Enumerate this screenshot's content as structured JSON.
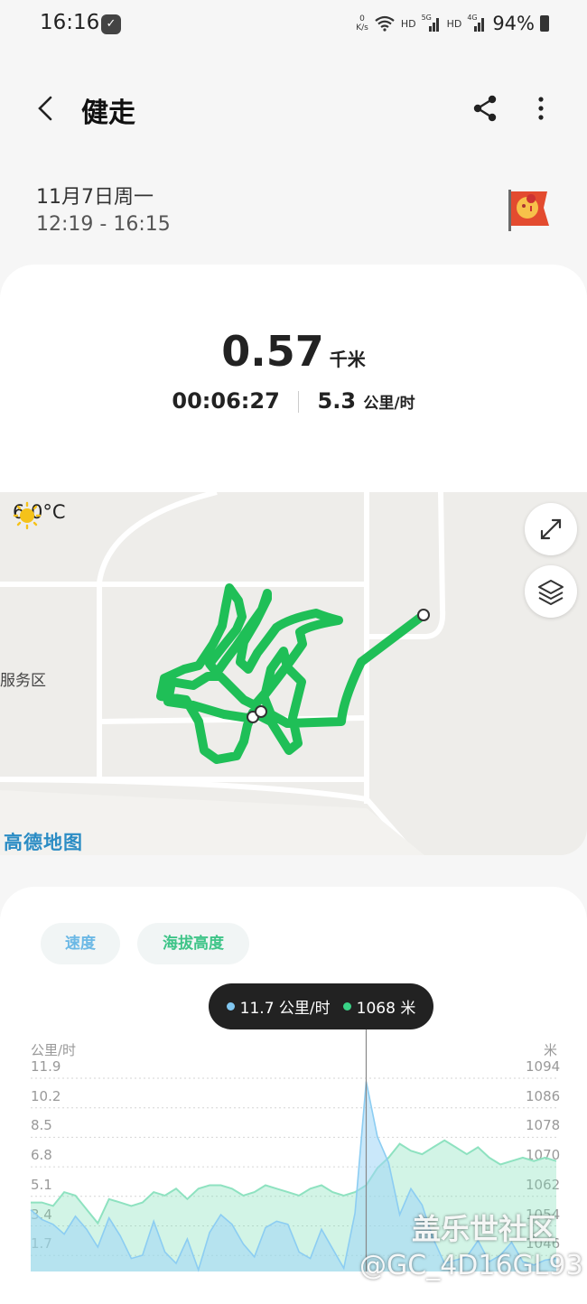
{
  "status": {
    "time": "16:16",
    "net_speed_value": "0",
    "net_speed_unit": "K/s",
    "hd1": "HD",
    "sig1": "5G",
    "hd2": "HD",
    "sig2": "4G",
    "battery": "94%"
  },
  "header": {
    "title": "健走"
  },
  "session": {
    "date": "11月7日周一",
    "time_range": "12:19 - 16:15"
  },
  "summary": {
    "distance_value": "0.57",
    "distance_unit": "千米",
    "duration": "00:06:27",
    "speed_value": "5.3",
    "speed_unit": "公里/时"
  },
  "map": {
    "temperature": "6.0°C",
    "poi_label": "服务区",
    "provider": "高德地图"
  },
  "tabs": {
    "speed": "速度",
    "altitude": "海拔高度"
  },
  "tooltip": {
    "speed": "11.7 公里/时",
    "altitude": "1068 米"
  },
  "chart_data": {
    "type": "area",
    "left_axis_title": "公里/时",
    "right_axis_title": "米",
    "left_ticks": [
      "11.9",
      "10.2",
      "8.5",
      "6.8",
      "5.1",
      "3.4",
      "1.7"
    ],
    "right_ticks": [
      "1094",
      "1086",
      "1078",
      "1070",
      "1062",
      "1054",
      "1046"
    ],
    "colors": {
      "speed": "#9fd6f5",
      "altitude": "#7de0b6"
    },
    "series": [
      {
        "name": "速度",
        "axis": "left",
        "values": [
          3.8,
          3.2,
          2.9,
          2.3,
          3.4,
          2.6,
          1.5,
          3.3,
          2.2,
          0.8,
          1.0,
          3.1,
          1.2,
          0.5,
          2.0,
          0.1,
          2.4,
          3.5,
          2.9,
          1.7,
          0.9,
          2.7,
          3.1,
          2.9,
          1.2,
          0.8,
          2.6,
          1.4,
          0.2,
          3.6,
          11.7,
          8.3,
          6.7,
          3.5,
          5.1,
          4.1,
          2.0,
          0.5,
          0.7,
          0.9,
          1.9,
          0.6,
          1.0,
          1.8,
          0.6,
          0.4,
          0.7,
          0.8
        ]
      },
      {
        "name": "海拔高度",
        "axis": "right",
        "values": [
          1058,
          1058,
          1057,
          1061,
          1060,
          1056,
          1052,
          1059,
          1058,
          1057,
          1058,
          1061,
          1060,
          1062,
          1059,
          1062,
          1063,
          1063,
          1062,
          1060,
          1061,
          1063,
          1062,
          1061,
          1060,
          1062,
          1063,
          1061,
          1060,
          1061,
          1063,
          1068,
          1071,
          1075,
          1073,
          1072,
          1074,
          1076,
          1074,
          1072,
          1074,
          1071,
          1069,
          1070,
          1071,
          1070,
          1071,
          1070
        ]
      }
    ]
  }
}
